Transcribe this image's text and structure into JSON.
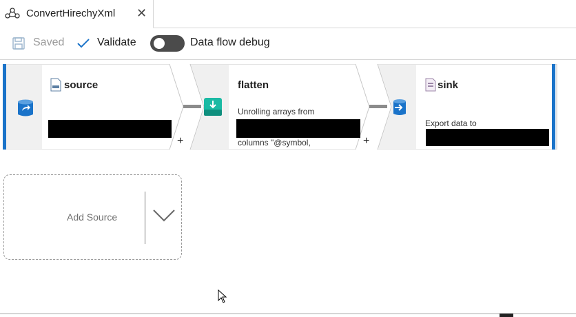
{
  "tab": {
    "title": "ConvertHirechyXml",
    "close": "✕"
  },
  "toolbar": {
    "saved_label": "Saved",
    "validate_label": "Validate",
    "debug_label": "Data flow debug",
    "debug_on": false
  },
  "nodes": {
    "source": {
      "title": "source"
    },
    "flatten": {
      "title": "flatten",
      "desc_line1": "Unrolling arrays from",
      "desc_line2": "columns \"@symbol,"
    },
    "sink": {
      "title": "sink",
      "desc_line1": "Export data to"
    }
  },
  "plus": "+",
  "add_source": {
    "label": "Add Source"
  },
  "colors": {
    "accent": "#1a73c9",
    "node_fill": "#f3f3f3",
    "toggle": "#4b4b4b"
  }
}
